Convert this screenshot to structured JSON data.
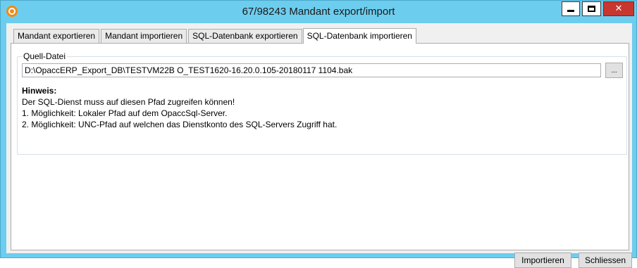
{
  "window": {
    "title": "67/98243 Mandant export/import",
    "icon": "opacc-app-icon",
    "controls": {
      "minimize": "minimize-icon",
      "maximize": "maximize-icon",
      "close": "close-icon",
      "close_glyph": "✕"
    }
  },
  "tabs": [
    {
      "label": "Mandant exportieren",
      "active": false
    },
    {
      "label": "Mandant importieren",
      "active": false
    },
    {
      "label": "SQL-Datenbank exportieren",
      "active": false
    },
    {
      "label": "SQL-Datenbank importieren",
      "active": true
    }
  ],
  "source_file": {
    "legend": "Quell-Datei",
    "path_value": "D:\\OpaccERP_Export_DB\\TESTVM22B O_TEST1620-16.20.0.105-20180117 1104.bak",
    "browse_label": "..."
  },
  "hint": {
    "title": "Hinweis:",
    "lines": [
      "Der SQL-Dienst muss auf diesen Pfad zugreifen können!",
      "1. Möglichkeit: Lokaler Pfad auf dem OpaccSql-Server.",
      "2. Möglichkeit: UNC-Pfad auf welchen das Dienstkonto des SQL-Servers Zugriff hat."
    ]
  },
  "actions": {
    "import_label": "Importieren",
    "close_label": "Schliessen"
  },
  "colors": {
    "titlebar": "#6dcdee",
    "close_button": "#c7372f",
    "app_icon": "#f28a12"
  }
}
